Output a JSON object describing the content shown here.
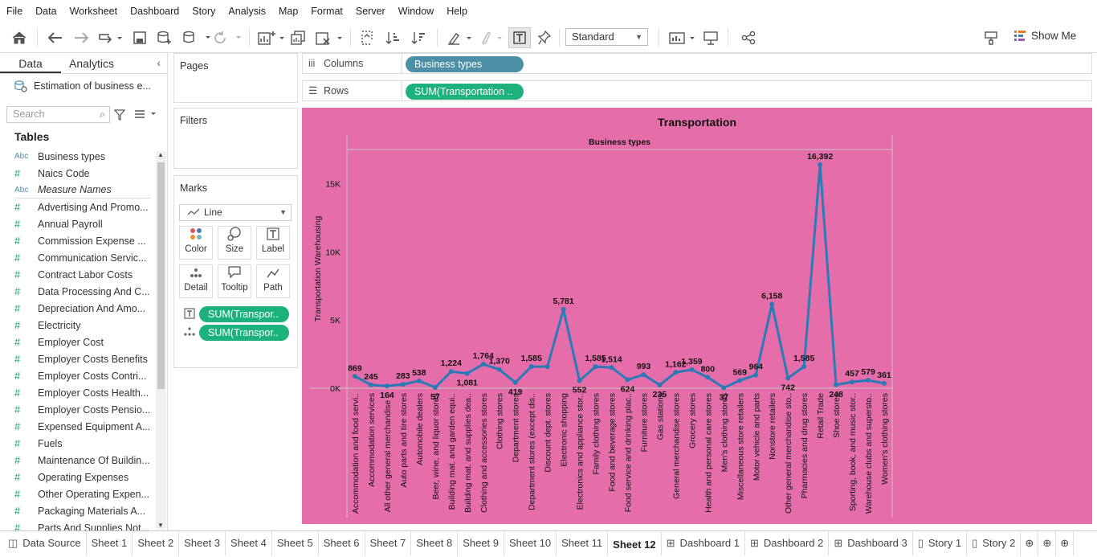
{
  "menu": [
    "File",
    "Data",
    "Worksheet",
    "Dashboard",
    "Story",
    "Analysis",
    "Map",
    "Format",
    "Server",
    "Window",
    "Help"
  ],
  "toolbar": {
    "fit_select": "Standard",
    "show_me": "Show Me"
  },
  "left_pane": {
    "tabs": [
      "Data",
      "Analytics"
    ],
    "datasource": "Estimation of business e...",
    "search_placeholder": "Search",
    "tables_heading": "Tables",
    "dimensions": [
      {
        "type": "Abc",
        "name": "Business types"
      },
      {
        "type": "#",
        "name": "Naics Code"
      },
      {
        "type": "Abc",
        "name": "Measure Names"
      }
    ],
    "measures": [
      "Advertising And Promo...",
      "Annual Payroll",
      "Commission Expense ...",
      "Communication Servic...",
      "Contract Labor Costs",
      "Data Processing And C...",
      "Depreciation And Amo...",
      "Electricity",
      "Employer Cost",
      "Employer Costs Benefits",
      "Employer Costs Contri...",
      "Employer Costs Health...",
      "Employer Costs Pensio...",
      "Expensed Equipment A...",
      "Fuels",
      "Maintenance Of Buildin...",
      "Operating Expenses",
      "Other Operating Expen...",
      "Packaging Materials A...",
      "Parts And Supplies Not..."
    ]
  },
  "cards": {
    "pages": "Pages",
    "filters": "Filters",
    "marks": "Marks",
    "mark_type": "Line",
    "buttons": [
      "Color",
      "Size",
      "Label",
      "Detail",
      "Tooltip",
      "Path"
    ],
    "mark_pills": [
      "SUM(Transpor..",
      "SUM(Transpor.."
    ]
  },
  "shelves": {
    "columns_label": "Columns",
    "columns_pill": "Business types",
    "rows_label": "Rows",
    "rows_pill": "SUM(Transportation .."
  },
  "sheet_tabs": [
    "Data Source",
    "Sheet 1",
    "Sheet 2",
    "Sheet 3",
    "Sheet 4",
    "Sheet 5",
    "Sheet 6",
    "Sheet 7",
    "Sheet 8",
    "Sheet 9",
    "Sheet 10",
    "Sheet 11",
    "Sheet 12",
    "Dashboard 1",
    "Dashboard 2",
    "Dashboard 3",
    "Story 1",
    "Story 2"
  ],
  "active_sheet": "Sheet 12",
  "chart_data": {
    "type": "line",
    "title": "Transportation",
    "header": "Business types",
    "ylabel": "Transportation  Warehousing",
    "ylim": [
      0,
      17500
    ],
    "yticks": [
      {
        "v": 0,
        "l": "0K"
      },
      {
        "v": 5000,
        "l": "5K"
      },
      {
        "v": 10000,
        "l": "10K"
      },
      {
        "v": 15000,
        "l": "15K"
      }
    ],
    "background": "#e56eaa",
    "line_color": "#2a7ab8",
    "categories": [
      "Accommodation and food servi..",
      "Accommodation services",
      "All other general merchandise ..",
      "Auto parts and tire stores",
      "Automobile dealers",
      "Beer, wine, and liquor stores",
      "Building mat. and garden equi..",
      "Building mat. and supplies dea..",
      "Clothing and accessories stores",
      "Clothing stores",
      "Department stores",
      "Department stores (except dis..",
      "Discount dept. stores",
      "Electronic shopping",
      "Electronics and appliance stor..",
      "Family clothing stores",
      "Food and beverage stores",
      "Food service and drinking plac..",
      "Furniture stores",
      "Gas stations",
      "General merchandise stores",
      "Grocery stores",
      "Health and personal care stores",
      "Men's clothing stores",
      "Miscellaneous store retailers",
      "Motor vehicle and parts",
      "Nonstore retailers",
      "Other general merchandise sto..",
      "Pharmacies and drug stores",
      "Retail Trade",
      "Shoe stores",
      "Sporting, book, and music stor..",
      "Warehouse clubs and supersto..",
      "Women's clothing stores"
    ],
    "values": [
      869,
      245,
      164,
      283,
      538,
      57,
      1224,
      1081,
      1764,
      1370,
      419,
      1585,
      1585,
      5781,
      552,
      1585,
      1514,
      624,
      993,
      235,
      1162,
      1359,
      800,
      37,
      569,
      964,
      6158,
      742,
      1585,
      16392,
      248,
      457,
      579,
      361
    ],
    "labels": [
      "869",
      "245",
      "164",
      "283",
      "538",
      "57",
      "1,224",
      "1,081",
      "1,764",
      "1,370",
      "419",
      "1,585",
      "",
      "5,781",
      "552",
      "1,585",
      "1,514",
      "624",
      "993",
      "235",
      "1,162",
      "1,359",
      "800",
      "37",
      "569",
      "964",
      "6,158",
      "742",
      "1,585",
      "16,392",
      "248",
      "457",
      "579",
      "361"
    ]
  }
}
